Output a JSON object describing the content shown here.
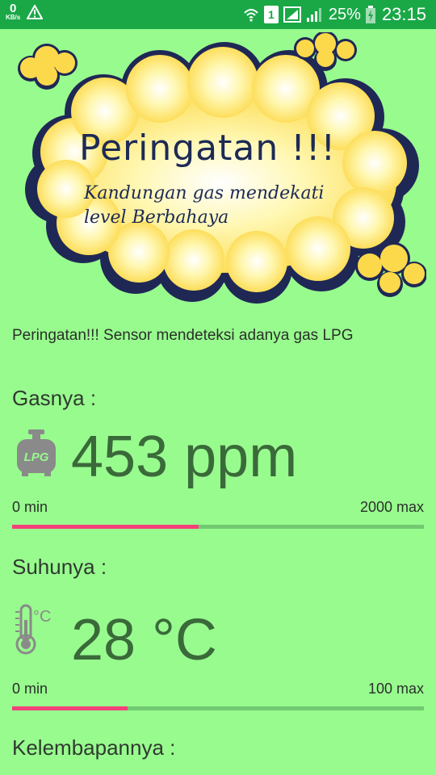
{
  "status_bar": {
    "kb_value": "0",
    "kb_unit": "KB/s",
    "sim_label": "1",
    "battery_percent": "25%",
    "time": "23:15"
  },
  "banner": {
    "title": "Peringatan !!!",
    "subtitle_line1": "Kandungan gas mendekati",
    "subtitle_line2": "level Berbahaya"
  },
  "warning_message": "Peringatan!!! Sensor mendeteksi adanya gas LPG",
  "gas": {
    "label": "Gasnya :",
    "icon_text": "LPG",
    "value": "453 ppm",
    "min_label": "0 min",
    "max_label": "2000 max",
    "bar_fraction": 0.4527
  },
  "temperature": {
    "label": "Suhunya :",
    "icon_unit": "°C",
    "value": "28 °C",
    "min_label": "0 min",
    "max_label": "100 max",
    "bar_fraction": 0.28
  },
  "humidity": {
    "label": "Kelembapannya :"
  },
  "colors": {
    "background": "#98fb8e",
    "status_bar": "#1aa847",
    "progress_fill": "#f2417a",
    "progress_track": "#72c972",
    "value_text": "#3a6a3a"
  }
}
